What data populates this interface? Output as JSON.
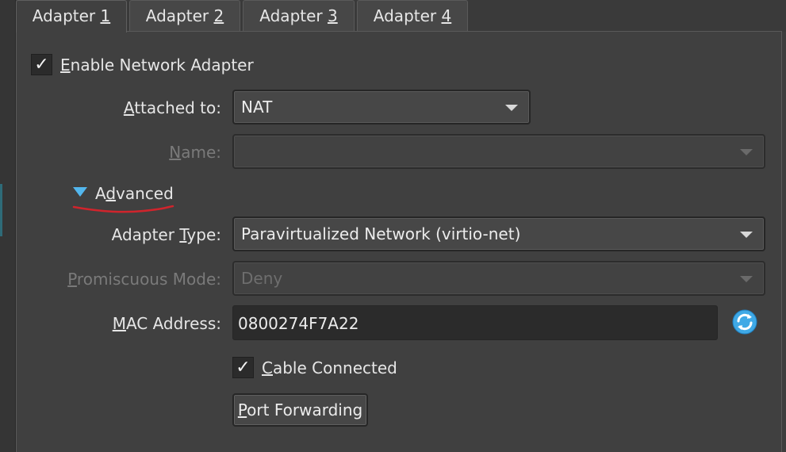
{
  "tabs": [
    {
      "prefix": "Adapter ",
      "mnemonic": "1"
    },
    {
      "prefix": "Adapter ",
      "mnemonic": "2"
    },
    {
      "prefix": "Adapter ",
      "mnemonic": "3"
    },
    {
      "prefix": "Adapter ",
      "mnemonic": "4"
    }
  ],
  "enable_adapter": {
    "checked_glyph": "✓",
    "mnemonic": "E",
    "rest": "nable Network Adapter"
  },
  "attached_to": {
    "mnemonic": "A",
    "rest": "ttached to:",
    "value": "NAT"
  },
  "name": {
    "mnemonic": "N",
    "rest": "ame:",
    "value": ""
  },
  "advanced": {
    "first": "A",
    "mnemonic": "d",
    "rest": "vanced"
  },
  "adapter_type": {
    "before": "Adapter ",
    "mnemonic": "T",
    "rest": "ype:",
    "value": "Paravirtualized Network (virtio-net)"
  },
  "promiscuous_mode": {
    "mnemonic": "P",
    "rest": "romiscuous Mode:",
    "value": "Deny"
  },
  "mac_address": {
    "mnemonic": "M",
    "rest": "AC Address:",
    "value": "0800274F7A22"
  },
  "cable_connected": {
    "checked_glyph": "✓",
    "mnemonic": "C",
    "rest": "able Connected"
  },
  "port_forwarding": {
    "mnemonic": "P",
    "rest": "ort Forwarding"
  },
  "colors": {
    "accent": "#53b7ee",
    "annotation": "#d0242c"
  }
}
